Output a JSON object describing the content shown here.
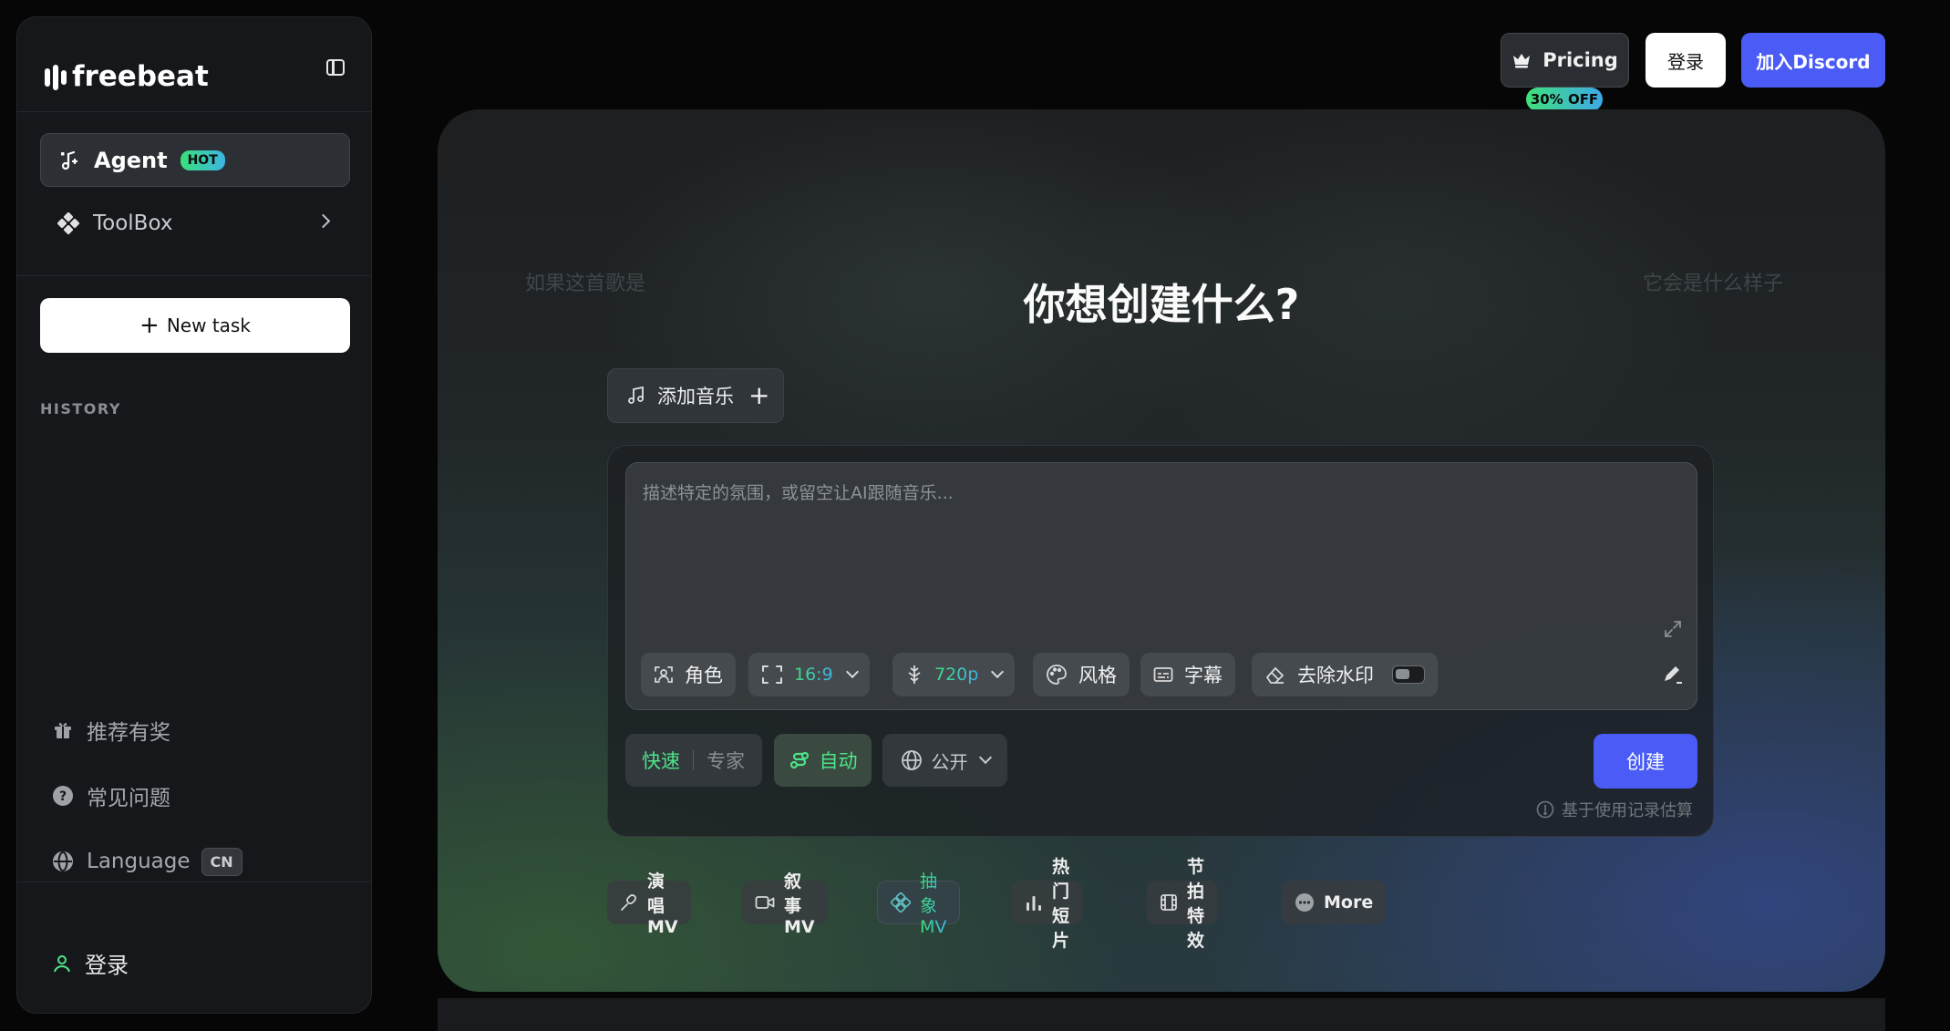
{
  "app": {
    "logo_text": "freebeat"
  },
  "sidebar": {
    "nav": [
      {
        "label": "Agent",
        "badge": "HOT",
        "icon": "music-sparkle-icon"
      },
      {
        "label": "ToolBox",
        "icon": "toolbox-icon"
      }
    ],
    "new_task_label": "New task",
    "history_label": "HISTORY",
    "links": [
      {
        "label": "推荐有奖",
        "icon": "gift-icon"
      },
      {
        "label": "常见问题",
        "icon": "help-circle-icon"
      },
      {
        "label": "Language",
        "badge": "CN",
        "icon": "globe-icon"
      }
    ],
    "login_label": "登录"
  },
  "header": {
    "pricing_label": "Pricing",
    "pricing_badge": "30% OFF",
    "login_label": "登录",
    "discord_label": "加入Discord"
  },
  "hero": {
    "side_left": "如果这首歌是",
    "side_right": "它会是什么样子",
    "title": "你想创建什么?",
    "add_music_label": "添加音乐",
    "prompt_placeholder": "描述特定的氛围，或留空让AI跟随音乐...",
    "options": [
      {
        "label": "角色",
        "icon": "face-scan-icon"
      },
      {
        "label": "16:9",
        "icon": "aspect-ratio-icon"
      },
      {
        "label": "720p",
        "icon": "resolution-icon"
      },
      {
        "label": "风格",
        "icon": "palette-icon"
      },
      {
        "label": "字幕",
        "icon": "subtitles-icon"
      },
      {
        "label": "去除水印",
        "icon": "eraser-icon"
      }
    ],
    "mode_fast": "快速",
    "mode_expert": "专家",
    "auto_label": "自动",
    "visibility_label": "公开",
    "create_label": "创建",
    "estimate_label": "基于使用记录估算",
    "templates": [
      {
        "label": "演唱 MV",
        "icon": "microphone-icon"
      },
      {
        "label": "叙事 MV",
        "icon": "video-camera-icon"
      },
      {
        "label": "抽象 MV",
        "icon": "abstract-icon"
      },
      {
        "label": "热门短片",
        "icon": "bar-chart-icon"
      },
      {
        "label": "节拍特效",
        "icon": "film-icon"
      },
      {
        "label": "More",
        "icon": "more-dots-icon"
      }
    ]
  },
  "colors": {
    "accent_blue": "#4a5cf5",
    "accent_green": "#4ee48a",
    "sidebar_bg": "#15171b"
  }
}
